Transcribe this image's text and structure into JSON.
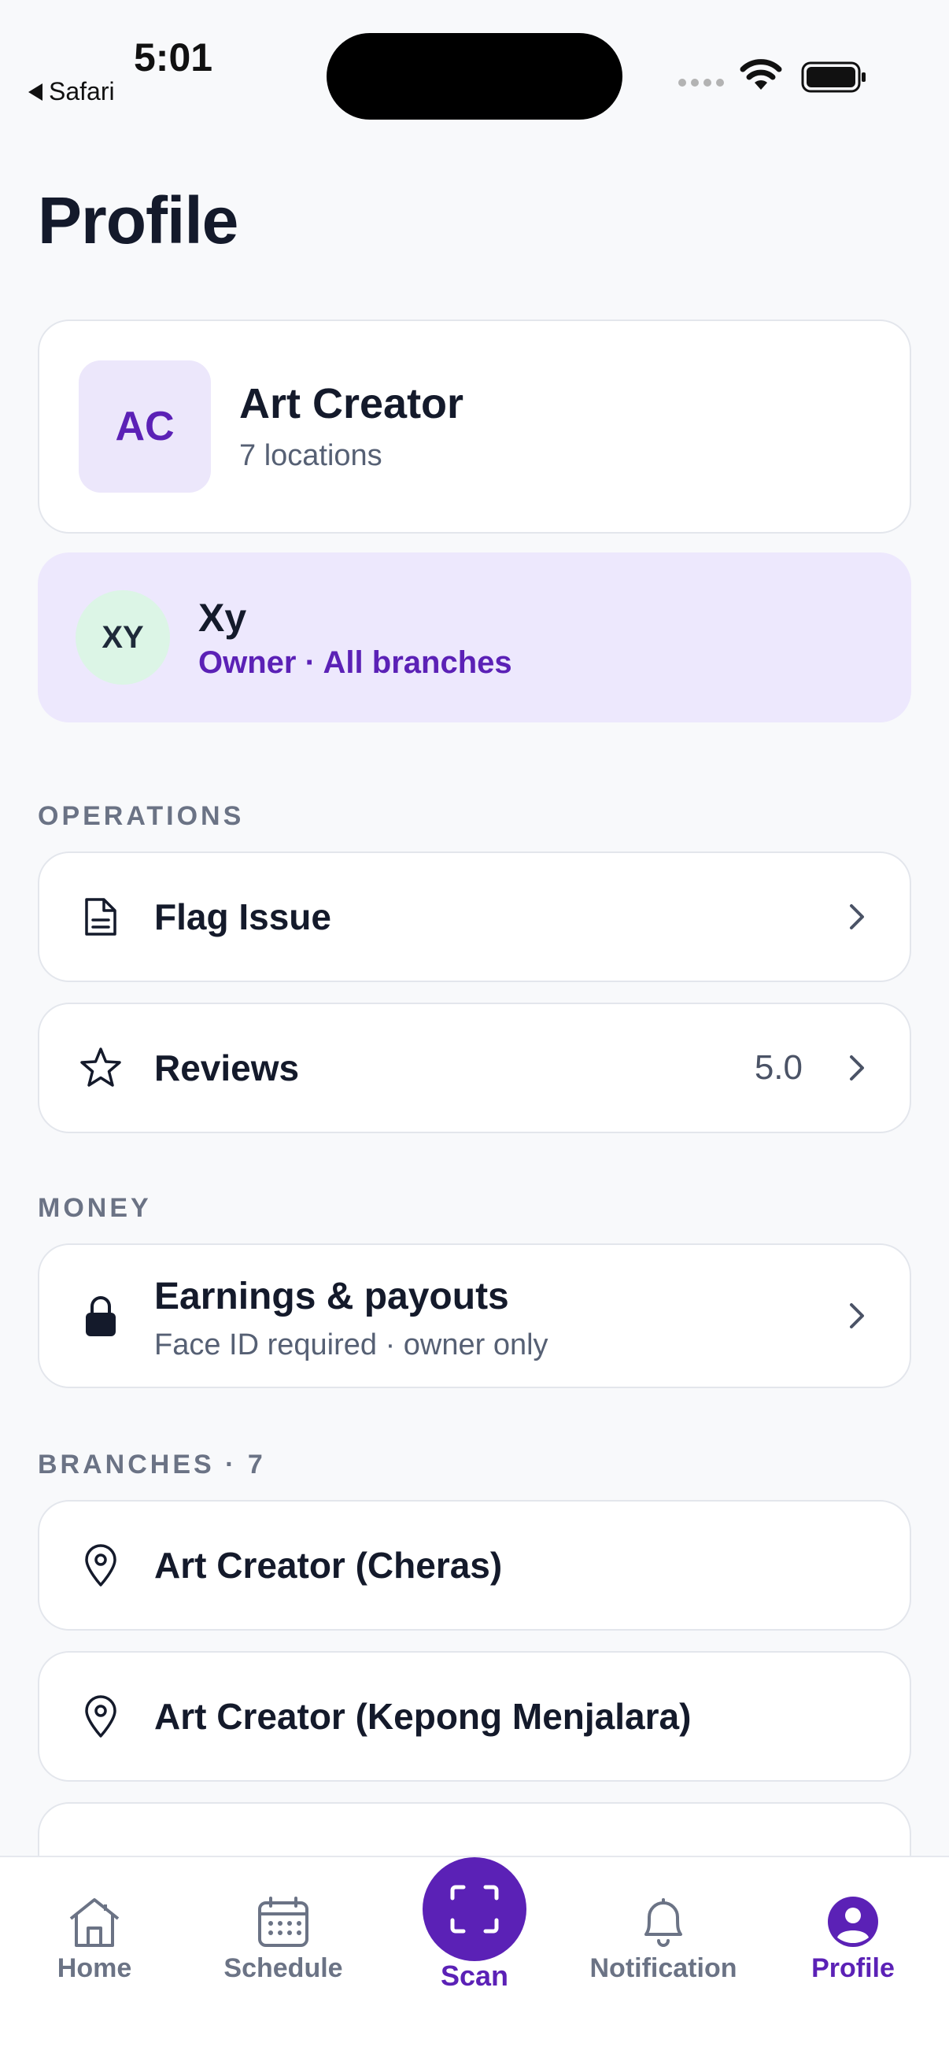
{
  "status_bar": {
    "time": "5:01",
    "back_app": "Safari"
  },
  "page": {
    "title": "Profile"
  },
  "business": {
    "initials": "AC",
    "name": "Art Creator",
    "subtitle": "7 locations"
  },
  "user": {
    "initials": "XY",
    "name": "Xy",
    "role": "Owner · All branches"
  },
  "sections": {
    "operations": "OPERATIONS",
    "money": "MONEY",
    "branches": "BRANCHES · 7"
  },
  "operations": {
    "flag_issue": {
      "label": "Flag Issue",
      "icon": "document-icon"
    },
    "reviews": {
      "label": "Reviews",
      "value": "5.0",
      "icon": "star-icon"
    }
  },
  "money": {
    "earnings": {
      "title": "Earnings & payouts",
      "subtitle": "Face ID required · owner only",
      "icon": "lock-icon"
    }
  },
  "branches": [
    {
      "name": "Art Creator (Cheras)",
      "icon": "map-pin-icon"
    },
    {
      "name": "Art Creator (Kepong Menjalara)",
      "icon": "map-pin-icon"
    }
  ],
  "tabbar": {
    "home": "Home",
    "schedule": "Schedule",
    "scan": "Scan",
    "notification": "Notification",
    "profile": "Profile",
    "active": "Profile"
  },
  "colors": {
    "accent": "#5b21b6",
    "accent_light": "#ede8fd",
    "background": "#f8f9fb"
  }
}
